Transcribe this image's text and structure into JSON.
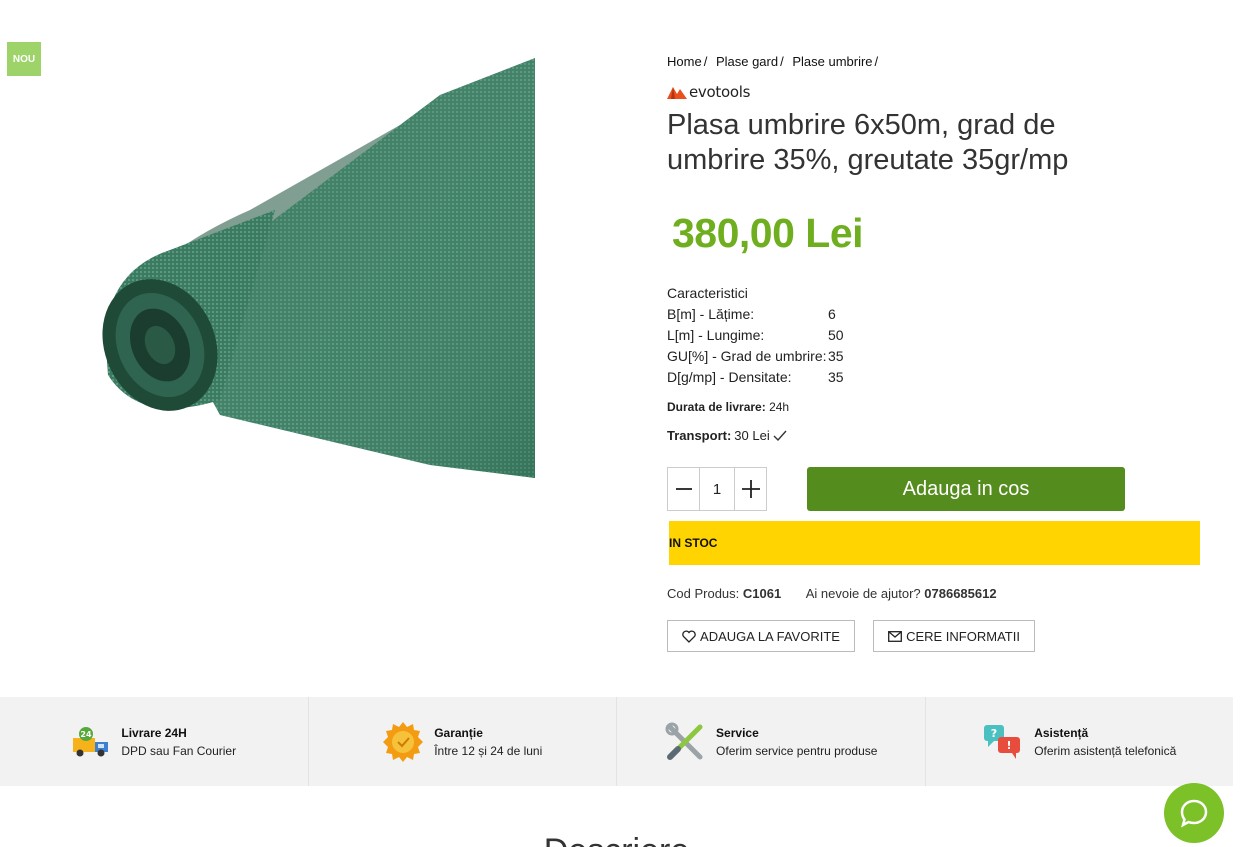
{
  "badge": "NOU",
  "breadcrumb": [
    {
      "label": "Home",
      "sep": "/"
    },
    {
      "label": "Plase gard",
      "sep": "/"
    },
    {
      "label": "Plase umbrire",
      "sep": "/"
    }
  ],
  "brand": "evotools",
  "title": "Plasa umbrire 6x50m, grad de umbrire 35%, greutate 35gr/mp",
  "price": "380,00 Lei",
  "specs": {
    "heading": "Caracteristici",
    "rows": [
      {
        "label": "B[m] - Lățime:",
        "value": "6"
      },
      {
        "label": "L[m] - Lungime:",
        "value": "50"
      },
      {
        "label": "GU[%] - Grad de umbrire:",
        "value": "35"
      },
      {
        "label": "D[g/mp] - Densitate:",
        "value": "35"
      }
    ]
  },
  "delivery": {
    "label": "Durata de livrare:",
    "value": "24h"
  },
  "transport": {
    "label": "Transport:",
    "value": "30 Lei"
  },
  "quantity": {
    "value": "1",
    "minus_icon": "minus-icon",
    "plus_icon": "plus-icon"
  },
  "add_to_cart": "Adauga in cos",
  "stock_status": "IN STOC",
  "meta": {
    "code_label": "Cod Produs:",
    "code": "C1061",
    "help_label": "Ai nevoie de ajutor?",
    "phone": "0786685612"
  },
  "buttons": {
    "favorite": "ADAUGA LA FAVORITE",
    "info": "CERE INFORMATII"
  },
  "features": [
    {
      "title": "Livrare 24H",
      "subtitle": "DPD sau Fan Courier",
      "icon": "delivery-truck-icon"
    },
    {
      "title": "Garanție",
      "subtitle": "Între 12 și 24 de luni",
      "icon": "warranty-badge-icon"
    },
    {
      "title": "Service",
      "subtitle": "Oferim service pentru produse",
      "icon": "service-tools-icon"
    },
    {
      "title": "Asistență",
      "subtitle": "Oferim asistență telefonică",
      "icon": "chat-support-icon"
    }
  ],
  "section_heading": "Descriere",
  "colors": {
    "price": "#6fae1f",
    "cart_button": "#558c1e",
    "stock_bg": "#ffd400",
    "badge_bg": "#9ed36a",
    "chat_bg": "#7cc128"
  }
}
